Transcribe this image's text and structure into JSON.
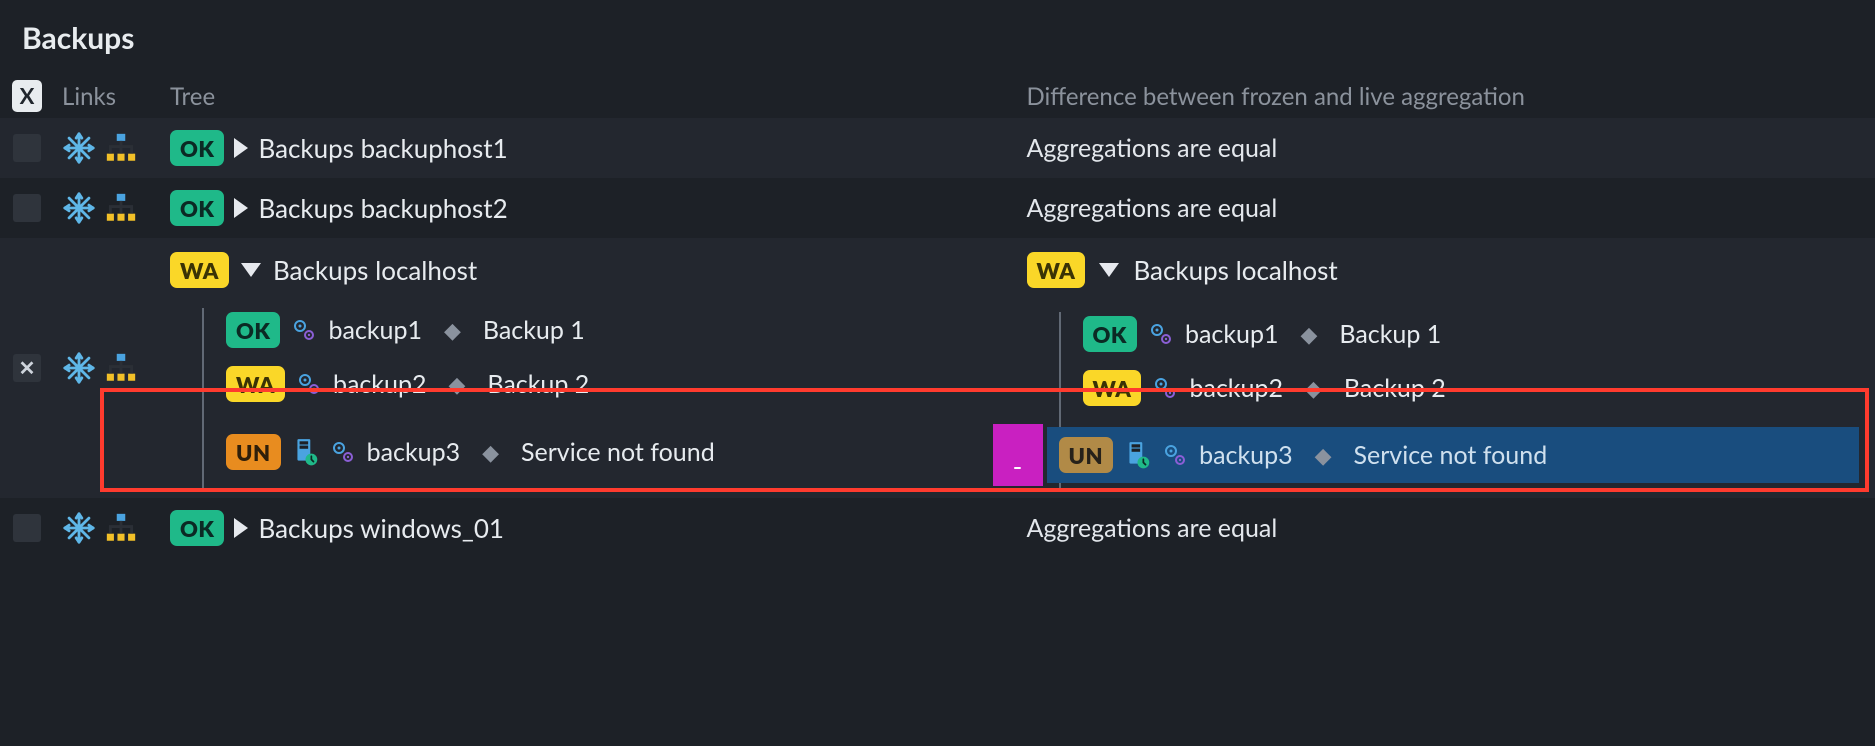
{
  "title": "Backups",
  "columns": {
    "x": "X",
    "links": "Links",
    "tree": "Tree",
    "diff": "Difference between frozen and live aggregation"
  },
  "status_labels": {
    "ok": "OK",
    "wa": "WA",
    "un": "UN"
  },
  "diff_equal_text": "Aggregations are equal",
  "magenta_char": "-",
  "rows": [
    {
      "id": "backuphost1",
      "selected": false,
      "status": "ok",
      "expanded": false,
      "tree_label": "Backups backuphost1",
      "diff": "equal"
    },
    {
      "id": "backuphost2",
      "selected": false,
      "status": "ok",
      "expanded": false,
      "tree_label": "Backups backuphost2",
      "diff": "equal"
    },
    {
      "id": "localhost",
      "selected": true,
      "status": "wa",
      "expanded": true,
      "tree_label": "Backups localhost",
      "children": [
        {
          "status": "ok",
          "name": "backup1",
          "desc": "Backup 1",
          "icons": [
            "service"
          ]
        },
        {
          "status": "wa",
          "name": "backup2",
          "desc": "Backup 2",
          "icons": [
            "service"
          ]
        },
        {
          "status": "un",
          "name": "backup3",
          "desc": "Service not found",
          "icons": [
            "host-time",
            "service"
          ],
          "highlight": true
        }
      ],
      "diff_tree": {
        "status": "wa",
        "label": "Backups localhost",
        "children": [
          {
            "status": "ok",
            "name": "backup1",
            "desc": "Backup 1",
            "icons": [
              "service"
            ]
          },
          {
            "status": "wa",
            "name": "backup2",
            "desc": "Backup 2",
            "icons": [
              "service"
            ]
          },
          {
            "status": "un",
            "status_variant": "un2",
            "name": "backup3",
            "desc": "Service not found",
            "icons": [
              "host-time",
              "service"
            ],
            "highlight": true,
            "blue": true,
            "magenta": true
          }
        ]
      }
    },
    {
      "id": "windows_01",
      "selected": false,
      "status": "ok",
      "expanded": false,
      "tree_label": "Backups windows_01",
      "diff": "equal"
    }
  ]
}
